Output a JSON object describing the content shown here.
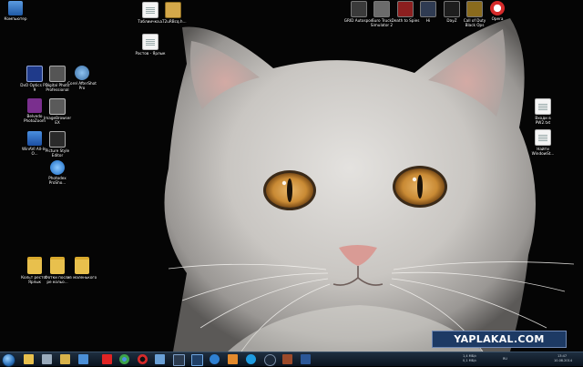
{
  "desktop": {
    "icons": [
      {
        "label": "Компьютер",
        "icon": "computer-icon",
        "color": "#2b6cb0"
      },
      {
        "label": "DxO Optics Pro 9",
        "icon": "dxo-icon",
        "color": "#1f3a8a"
      },
      {
        "label": "Digital Photo Professional",
        "icon": "dpp-icon",
        "color": "#555555"
      },
      {
        "label": "Corel AfterShot Pro",
        "icon": "aftershot-icon",
        "color": "#3a6ea5"
      },
      {
        "label": "Belvedo PhotoZoom",
        "icon": "photozoom-icon",
        "color": "#7a2f8e"
      },
      {
        "label": "ImageBrowser EX",
        "icon": "imagebrowser-icon",
        "color": "#5a5a5a"
      },
      {
        "label": "WinAVI All-In-O...",
        "icon": "winavi-icon",
        "color": "#1c4fa3"
      },
      {
        "label": "Picture Style Editor",
        "icon": "picturestyle-icon",
        "color": "#2a2a2a"
      },
      {
        "label": "Photodex ProSho...",
        "icon": "proshow-icon",
        "color": "#1567c2"
      },
      {
        "label": "Кольт ресто - Ярлык",
        "icon": "shortcut-folder-icon",
        "color": "#e8c04d"
      },
      {
        "label": "Фотки после ре кольо...",
        "icon": "folder-icon",
        "color": "#e8c04d"
      },
      {
        "label": "из маленького",
        "icon": "folder-icon",
        "color": "#e8c04d"
      },
      {
        "label": "Таблиичка...",
        "icon": "document-icon",
        "color": "#f4f4f4"
      },
      {
        "label": "аТ2uRBcq.h...",
        "icon": "archive-icon",
        "color": "#d4a84a"
      },
      {
        "label": "Растов - Ярлык",
        "icon": "shortcut-icon",
        "color": "#5578b8"
      },
      {
        "label": "GRID Autosport",
        "icon": "grid-game-icon",
        "color": "#3a3a3a"
      },
      {
        "label": "Euro Truck Simulator 2",
        "icon": "ets2-game-icon",
        "color": "#6b6b6b"
      },
      {
        "label": "Death to Spies",
        "icon": "death-to-spies-icon",
        "color": "#8c1f1f"
      },
      {
        "label": "Hi",
        "icon": "game-icon",
        "color": "#2f3b52"
      },
      {
        "label": "DayZ",
        "icon": "dayz-icon",
        "color": "#1e1e1e"
      },
      {
        "label": "Call of Duty Black Ops",
        "icon": "cod-icon",
        "color": "#8a6b1d"
      },
      {
        "label": "Opera",
        "icon": "opera-icon",
        "color": "#d62a2a"
      },
      {
        "label": "Входи в PW2.txt",
        "icon": "text-file-icon",
        "color": "#f4f4f4"
      },
      {
        "label": "Найти WindowSt...",
        "icon": "text-file-icon",
        "color": "#f4f4f4"
      }
    ]
  },
  "watermark": {
    "text": "YAPLAKAL.COM"
  },
  "taskbar": {
    "start_label": "Пуск",
    "pinned": [
      {
        "name": "explorer",
        "icon": "folder-icon",
        "color": "#e8c04d"
      },
      {
        "name": "recycle",
        "icon": "recycle-icon",
        "color": "#9ab"
      },
      {
        "name": "files",
        "icon": "files-icon",
        "color": "#d8b24a"
      },
      {
        "name": "media",
        "icon": "media-icon",
        "color": "#4b8fd6"
      },
      {
        "name": "yandex",
        "icon": "yandex-icon",
        "color": "#e02424"
      },
      {
        "name": "chrome",
        "icon": "chrome-icon",
        "color": "#3da34a"
      },
      {
        "name": "opera",
        "icon": "opera-icon",
        "color": "#d62a2a"
      },
      {
        "name": "notepad",
        "icon": "notepad-icon",
        "color": "#6aa0d6"
      },
      {
        "name": "lightroom",
        "icon": "lightroom-icon",
        "color": "#2b3a4e"
      },
      {
        "name": "photoshop",
        "icon": "photoshop-icon",
        "color": "#1f3f66"
      },
      {
        "name": "ie",
        "icon": "ie-icon",
        "color": "#2f80d1"
      },
      {
        "name": "paint",
        "icon": "paint-icon",
        "color": "#e38a2c"
      },
      {
        "name": "skype",
        "icon": "skype-icon",
        "color": "#1e9be0"
      },
      {
        "name": "steam",
        "icon": "steam-icon",
        "color": "#1b2838"
      },
      {
        "name": "total",
        "icon": "app-icon",
        "color": "#9c4a2a"
      },
      {
        "name": "word",
        "icon": "word-icon",
        "color": "#2b5797"
      }
    ],
    "tray": {
      "net_up": "1,4 МБ/с",
      "net_down": "0,1 МБ/с",
      "lang": "RU",
      "time": "13:47",
      "date": "10.08.2014"
    }
  }
}
